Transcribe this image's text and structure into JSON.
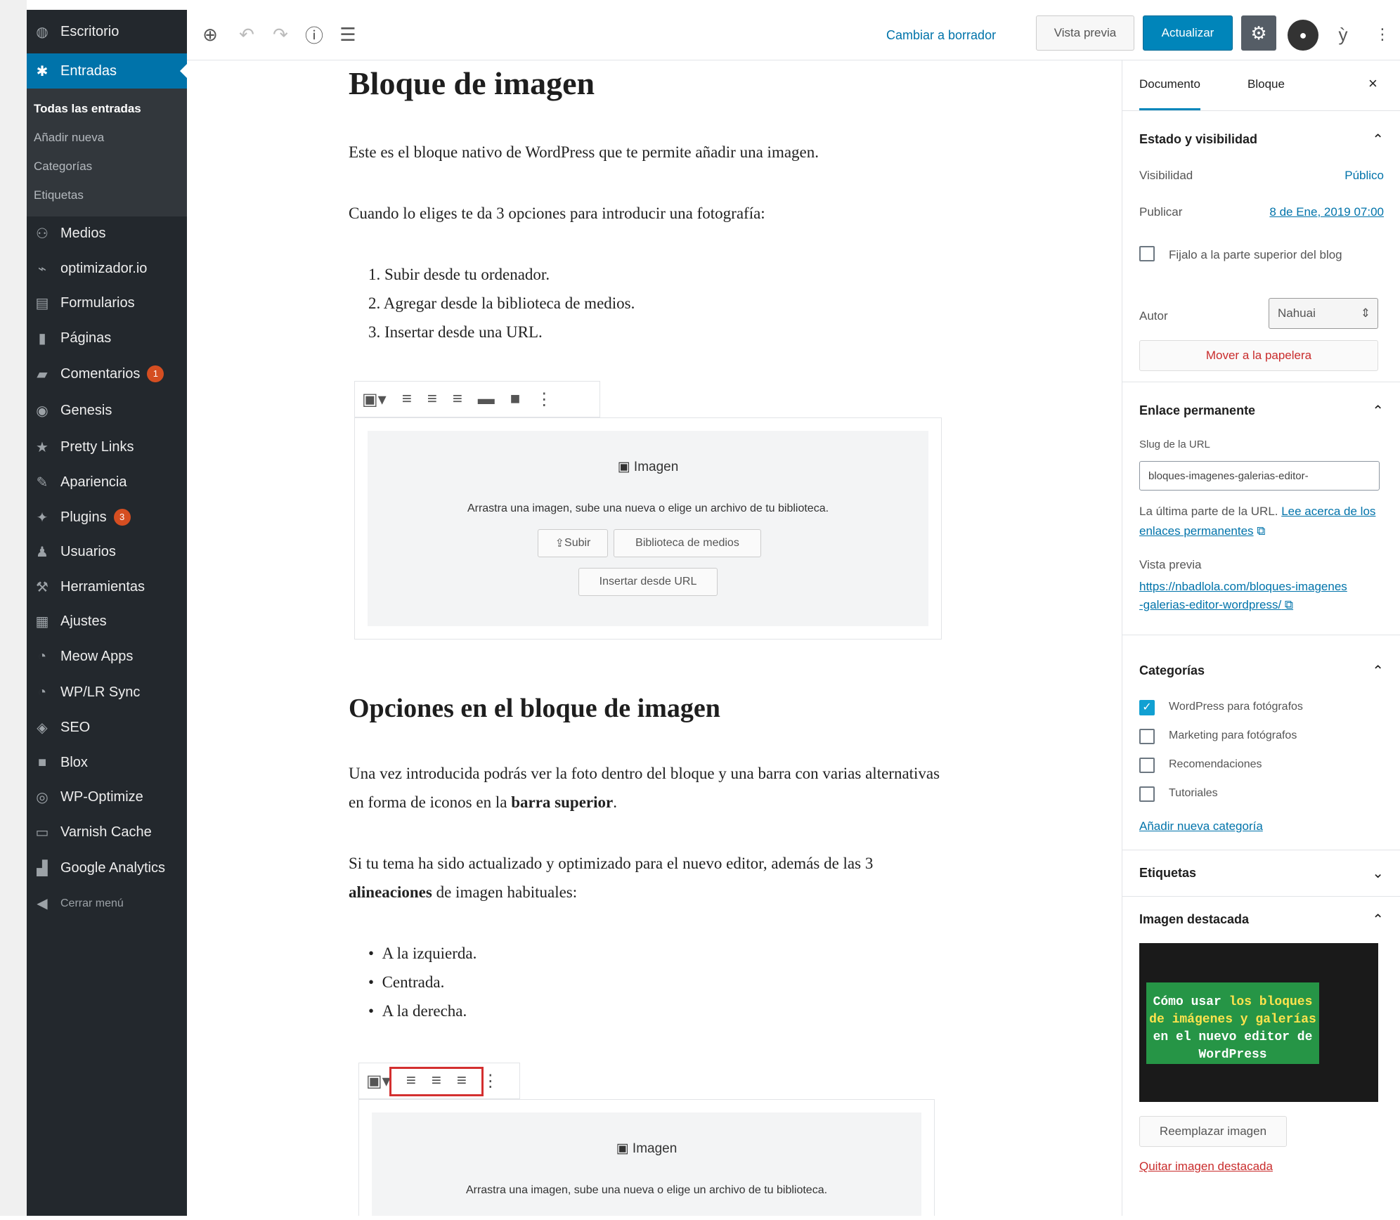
{
  "admin_menu": {
    "dashboard": "Escritorio",
    "posts": "Entradas",
    "posts_sub": [
      "Todas las entradas",
      "Añadir nueva",
      "Categorías",
      "Etiquetas"
    ],
    "items": [
      {
        "label": "Medios",
        "icon": "media-icon"
      },
      {
        "label": "optimizador.io",
        "icon": "optimizador-icon"
      },
      {
        "label": "Formularios",
        "icon": "forms-icon"
      },
      {
        "label": "Páginas",
        "icon": "pages-icon"
      },
      {
        "label": "Comentarios",
        "icon": "comments-icon",
        "badge": "1"
      },
      {
        "label": "Genesis",
        "icon": "genesis-icon"
      },
      {
        "label": "Pretty Links",
        "icon": "pretty-links-icon"
      },
      {
        "label": "Apariencia",
        "icon": "appearance-icon"
      },
      {
        "label": "Plugins",
        "icon": "plugins-icon",
        "badge": "3"
      },
      {
        "label": "Usuarios",
        "icon": "users-icon"
      },
      {
        "label": "Herramientas",
        "icon": "tools-icon"
      },
      {
        "label": "Ajustes",
        "icon": "settings-icon"
      },
      {
        "label": "Meow Apps",
        "icon": "meow-apps-icon"
      },
      {
        "label": "WP/LR Sync",
        "icon": "wplr-sync-icon"
      },
      {
        "label": "SEO",
        "icon": "seo-icon"
      },
      {
        "label": "Blox",
        "icon": "blox-icon"
      },
      {
        "label": "WP-Optimize",
        "icon": "wp-optimize-icon"
      },
      {
        "label": "Varnish Cache",
        "icon": "varnish-icon"
      },
      {
        "label": "Google Analytics",
        "icon": "analytics-icon"
      },
      {
        "label": "Cerrar menú",
        "icon": "collapse-menu-icon"
      }
    ]
  },
  "toolbar": {
    "switch_draft": "Cambiar a borrador",
    "preview": "Vista previa",
    "update": "Actualizar"
  },
  "content": {
    "h1": "Bloque de imagen",
    "p1": "Este es el bloque nativo de WordPress que te permite añadir una imagen.",
    "p2": "Cuando lo eliges te da 3 opciones para introducir una fotografía:",
    "ol": [
      "1.  Subir desde tu ordenador.",
      "2.  Agregar desde la biblioteca de medios.",
      "3.  Insertar desde una URL."
    ],
    "image_block": {
      "title": "Imagen",
      "desc": "Arrastra una imagen, sube una nueva o elige un archivo de tu biblioteca.",
      "upload": "Subir",
      "library": "Biblioteca de medios",
      "insert_url": "Insertar desde URL"
    },
    "h2": "Opciones en el bloque de imagen",
    "p3a": "Una vez introducida podrás ver la foto dentro del bloque y una barra con varias alternativas en forma de iconos en la ",
    "p3b": "barra superior",
    "p3c": ".",
    "p4a": "Si tu tema ha sido actualizado y optimizado para el nuevo editor, además de las 3 ",
    "p4b": "alineaciones",
    "p4c": " de imagen habituales:",
    "ul": [
      "A la izquierda.",
      "Centrada.",
      "A la derecha."
    ]
  },
  "panel": {
    "tabs": [
      "Documento",
      "Bloque"
    ],
    "status": {
      "title": "Estado y visibilidad",
      "visibility_label": "Visibilidad",
      "visibility_value": "Público",
      "publish_label": "Publicar",
      "publish_value": "8 de Ene, 2019 07:00",
      "stick": "Fijalo a la parte superior del blog",
      "author_label": "Autor",
      "author_value": "Nahuai",
      "trash": "Mover a la papelera"
    },
    "permalink": {
      "title": "Enlace permanente",
      "slug_label": "Slug de la URL",
      "slug_value": "bloques-imagenes-galerias-editor-",
      "help_a": "La última parte de la URL. ",
      "help_link": "Lee acerca de los enlaces permanentes",
      "preview_label": "Vista previa",
      "preview_url": "https://nbadlola.com/bloques-imagenes-galerias-editor-wordpress/"
    },
    "categories": {
      "title": "Categorías",
      "items": [
        {
          "label": "WordPress para fotógrafos",
          "checked": true
        },
        {
          "label": "Marketing para fotógrafos",
          "checked": false
        },
        {
          "label": "Recomendaciones",
          "checked": false
        },
        {
          "label": "Tutoriales",
          "checked": false
        }
      ],
      "add": "Añadir nueva categoría"
    },
    "tags": {
      "title": "Etiquetas"
    },
    "featured": {
      "title": "Imagen destacada",
      "img_text_a": "Cómo usar ",
      "img_text_b": "los bloques de imágenes y galerías",
      "img_text_c": " en el nuevo editor de WordPress",
      "replace": "Reemplazar imagen",
      "remove": "Quitar imagen destacada"
    }
  }
}
